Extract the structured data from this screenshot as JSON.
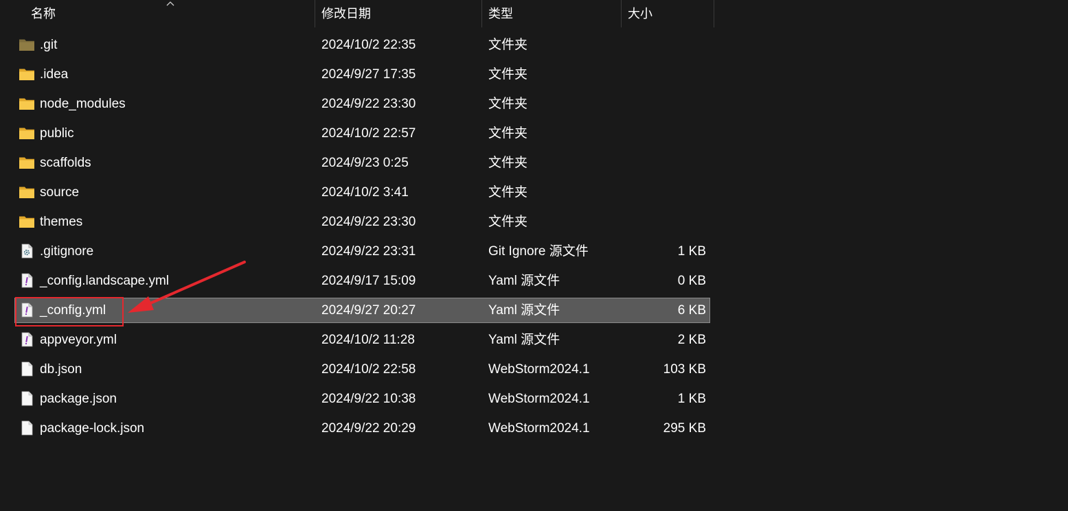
{
  "columns": {
    "name": "名称",
    "date": "修改日期",
    "type": "类型",
    "size": "大小"
  },
  "rows": [
    {
      "icon": "folder-icon-git",
      "name": ".git",
      "date": "2024/10/2 22:35",
      "type": "文件夹",
      "size": ""
    },
    {
      "icon": "folder-icon",
      "name": ".idea",
      "date": "2024/9/27 17:35",
      "type": "文件夹",
      "size": ""
    },
    {
      "icon": "folder-icon",
      "name": "node_modules",
      "date": "2024/9/22 23:30",
      "type": "文件夹",
      "size": ""
    },
    {
      "icon": "folder-icon",
      "name": "public",
      "date": "2024/10/2 22:57",
      "type": "文件夹",
      "size": ""
    },
    {
      "icon": "folder-icon",
      "name": "scaffolds",
      "date": "2024/9/23 0:25",
      "type": "文件夹",
      "size": ""
    },
    {
      "icon": "folder-icon",
      "name": "source",
      "date": "2024/10/2 3:41",
      "type": "文件夹",
      "size": ""
    },
    {
      "icon": "folder-icon",
      "name": "themes",
      "date": "2024/9/22 23:30",
      "type": "文件夹",
      "size": ""
    },
    {
      "icon": "settings-file-icon",
      "name": ".gitignore",
      "date": "2024/9/22 23:31",
      "type": "Git Ignore 源文件",
      "size": "1 KB"
    },
    {
      "icon": "yaml-file-icon",
      "name": "_config.landscape.yml",
      "date": "2024/9/17 15:09",
      "type": "Yaml 源文件",
      "size": "0 KB"
    },
    {
      "icon": "yaml-file-icon",
      "name": "_config.yml",
      "date": "2024/9/27 20:27",
      "type": "Yaml 源文件",
      "size": "6 KB",
      "selected": true
    },
    {
      "icon": "yaml-file-icon",
      "name": "appveyor.yml",
      "date": "2024/10/2 11:28",
      "type": "Yaml 源文件",
      "size": "2 KB"
    },
    {
      "icon": "file-icon",
      "name": "db.json",
      "date": "2024/10/2 22:58",
      "type": "WebStorm2024.1",
      "size": "103 KB"
    },
    {
      "icon": "file-icon",
      "name": "package.json",
      "date": "2024/9/22 10:38",
      "type": "WebStorm2024.1",
      "size": "1 KB"
    },
    {
      "icon": "file-icon",
      "name": "package-lock.json",
      "date": "2024/9/22 20:29",
      "type": "WebStorm2024.1",
      "size": "295 KB"
    }
  ],
  "colors": {
    "background": "#191919",
    "selected_row": "#5a5a5a",
    "folder": "#f8c94c",
    "annotation": "#e5282e"
  }
}
